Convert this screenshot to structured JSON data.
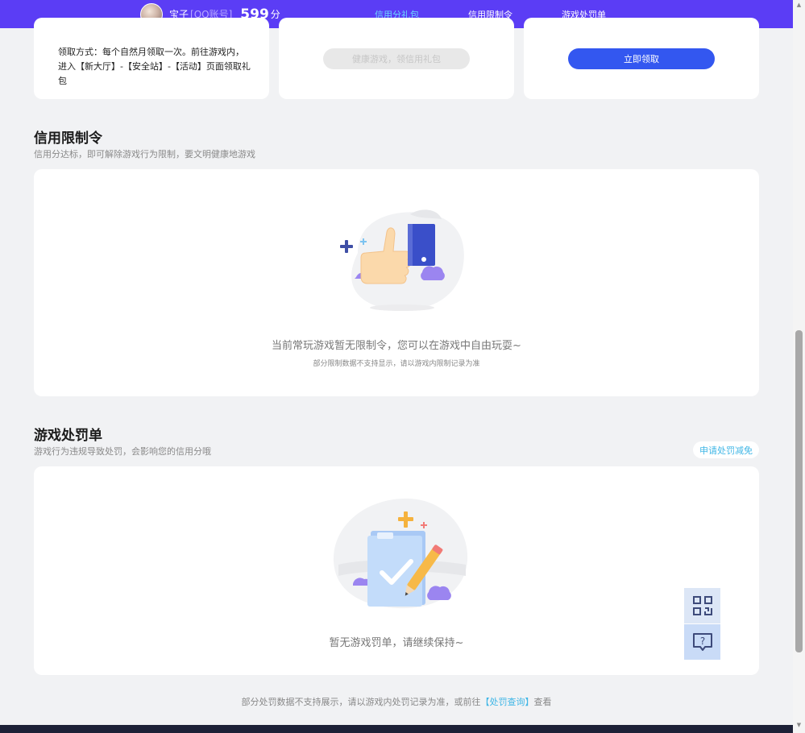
{
  "header": {
    "username": "宝子",
    "account_type": "[QQ账号]",
    "score": "599",
    "score_unit": "分",
    "nav": [
      {
        "label": "信用分礼包",
        "active": true
      },
      {
        "label": "信用限制令",
        "active": false
      },
      {
        "label": "游戏处罚单",
        "active": false
      }
    ]
  },
  "gift_cards": {
    "card1_text": "领取方式：每个自然月领取一次。前往游戏内，进入【新大厅】-【安全站】-【活动】页面领取礼包",
    "card2_button": "健康游戏，领信用礼包",
    "card3_button": "立即领取"
  },
  "restriction": {
    "title": "信用限制令",
    "subtitle": "信用分达标，即可解除游戏行为限制，要文明健康地游戏",
    "empty_text": "当前常玩游戏暂无限制令，您可以在游戏中自由玩耍~",
    "empty_note": "部分限制数据不支持显示，请以游戏内限制记录为准"
  },
  "penalty": {
    "title": "游戏处罚单",
    "subtitle": "游戏行为违规导致处罚，会影响您的信用分哦",
    "appeal_button": "申请处罚减免",
    "empty_text": "暂无游戏罚单，请继续保持~"
  },
  "footer": {
    "note_before": "部分处罚数据不支持展示，请以游戏内处罚记录为准，或前往",
    "link": "【处罚查询】",
    "note_after": "查看"
  },
  "icons": {
    "qr": "qr-code-icon",
    "help": "help-chat-icon"
  },
  "colors": {
    "topbar": "#5b3df5",
    "primary_button": "#3357f0",
    "link": "#3fb6e6",
    "active_nav": "#6dd7ff"
  }
}
